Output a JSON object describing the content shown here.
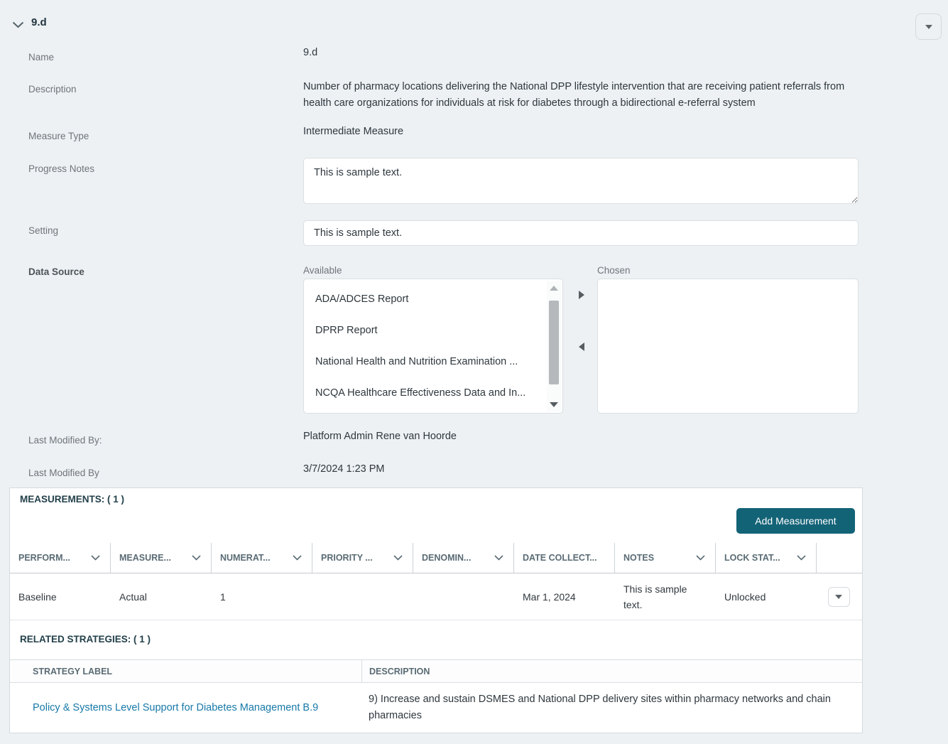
{
  "header": {
    "title": "9.d"
  },
  "form": {
    "name": {
      "label": "Name",
      "value": "9.d"
    },
    "description": {
      "label": "Description",
      "value": "Number of pharmacy locations delivering the National DPP lifestyle intervention that are receiving patient referrals from health care organizations for individuals at risk for diabetes through a bidirectional e-referral system"
    },
    "measure_type": {
      "label": "Measure Type",
      "value": "Intermediate Measure"
    },
    "progress_notes": {
      "label": "Progress Notes",
      "value": "This is sample text."
    },
    "setting": {
      "label": "Setting",
      "value": "This is sample text."
    },
    "data_source": {
      "label": "Data Source",
      "available_label": "Available",
      "chosen_label": "Chosen",
      "available_options": [
        "ADA/ADCES Report",
        "DPRP Report",
        "National Health and Nutrition Examination ...",
        "NCQA Healthcare Effectiveness Data and In..."
      ],
      "chosen_options": []
    },
    "last_modified_by": {
      "label": "Last Modified By:",
      "value": "Platform Admin Rene van Hoorde"
    },
    "last_modified_date": {
      "label": "Last Modified By",
      "value": "3/7/2024 1:23 PM"
    }
  },
  "measurements": {
    "title": "MEASUREMENTS: ( 1 )",
    "add_button_label": "Add Measurement",
    "columns": {
      "performance": "PERFORM...",
      "measure": "MEASURE...",
      "numerator": "NUMERAT...",
      "priority": "PRIORITY ...",
      "denominator": "DENOMIN...",
      "date_collected": "DATE COLLECT...",
      "notes": "NOTES",
      "lock_status": "LOCK STAT..."
    },
    "row": {
      "performance": "Baseline",
      "measure": "Actual",
      "numerator": "1",
      "priority": "",
      "denominator": "",
      "date_collected": "Mar 1, 2024",
      "notes": "This is sample text.",
      "lock_status": "Unlocked"
    }
  },
  "related_strategies": {
    "title": "RELATED STRATEGIES: ( 1 )",
    "columns": {
      "strategy_label": "STRATEGY LABEL",
      "description": "DESCRIPTION"
    },
    "row": {
      "strategy_label": "Policy & Systems Level Support for Diabetes Management B.9",
      "description": "9) Increase and sustain DSMES and National DPP delivery sites within pharmacy networks and chain pharmacies"
    }
  },
  "colors": {
    "page_background": "#edf1f4",
    "accent_teal": "#136377",
    "link": "#1779a8"
  }
}
